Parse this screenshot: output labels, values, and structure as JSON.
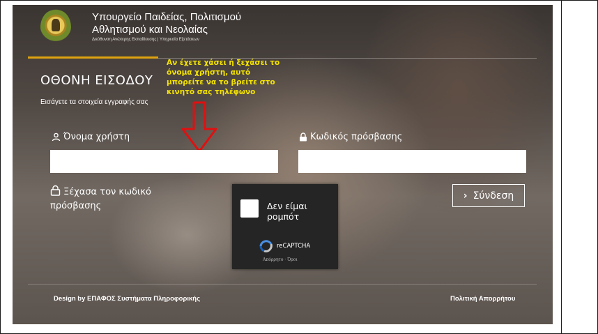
{
  "header": {
    "ministry_line1": "Υπουργείο Παιδείας, Πολιτισμού",
    "ministry_line2": "Αθλητισμού και Νεολαίας",
    "ministry_line3": "Διεύθυνση Ανώτερης Εκπαίδευσης | Υπηρεσία Εξετάσεων"
  },
  "page": {
    "title": "ΟΘΟΝΗ ΕΙΣΟΔΟΥ",
    "subtitle": "Εισάγετε τα στοιχεία εγγραφής σας"
  },
  "annotation": {
    "note": "Αν έχετε χάσει ή ξεχάσει το όνομα χρήστη, αυτό μπορείτε να το βρείτε στο κινητό σας τηλέφωνο",
    "color": "#f4e300",
    "arrow_color": "#e01010"
  },
  "form": {
    "username_label": "Όνομα χρήστη",
    "username_value": "",
    "password_label": "Κωδικός πρόσβασης",
    "password_value": "",
    "forgot_password": "Ξέχασα τον κωδικό πρόσβασης",
    "login_button": "Σύνδεση"
  },
  "recaptcha": {
    "checkbox_label": "Δεν είμαι ρομπότ",
    "brand": "reCAPTCHA",
    "links": "Απόρρητο · Όροι"
  },
  "footer": {
    "credit": "Design by ΕΠΑΦΟΣ Συστήματα Πληροφορικής",
    "privacy": "Πολιτική Απορρήτου"
  },
  "colors": {
    "accent_gold": "#e0a30f",
    "text": "#ffffff"
  }
}
